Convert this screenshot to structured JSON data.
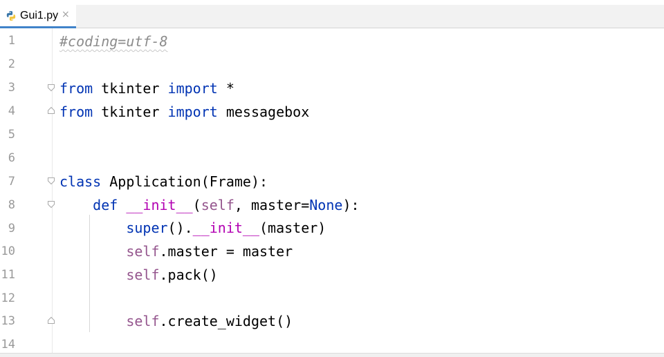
{
  "tab": {
    "filename": "Gui1.py",
    "close_glyph": "×",
    "icon": "python-file-icon"
  },
  "line_numbers": [
    "1",
    "2",
    "3",
    "4",
    "5",
    "6",
    "7",
    "8",
    "9",
    "10",
    "11",
    "12",
    "13",
    "14"
  ],
  "code": {
    "l1_comment": "#coding=utf-8",
    "l3_from": "from",
    "l3_module": " tkinter ",
    "l3_import": "import",
    "l3_rest": " *",
    "l4_from": "from",
    "l4_module": " tkinter ",
    "l4_import": "import",
    "l4_rest": " messagebox",
    "l7_class": "class",
    "l7_rest": " Application(Frame):",
    "l8_indent": "    ",
    "l8_def": "def",
    "l8_sp": " ",
    "l8_init": "__init__",
    "l8_paren": "(",
    "l8_self": "self",
    "l8_mid": ", master=",
    "l8_none": "None",
    "l8_end": "):",
    "l9_indent": "        ",
    "l9_super": "super",
    "l9_dot": "().",
    "l9_init": "__init__",
    "l9_end": "(master)",
    "l10_indent": "        ",
    "l10_self": "self",
    "l10_rest": ".master = master",
    "l11_indent": "        ",
    "l11_self": "self",
    "l11_rest": ".pack()",
    "l13_indent": "        ",
    "l13_self": "self",
    "l13_rest": ".create_widget()"
  },
  "colors": {
    "keyword": "#0033b3",
    "self": "#94558d",
    "dunder": "#b200b2",
    "comment": "#8c8c8c",
    "tab_underline": "#4083c9"
  }
}
